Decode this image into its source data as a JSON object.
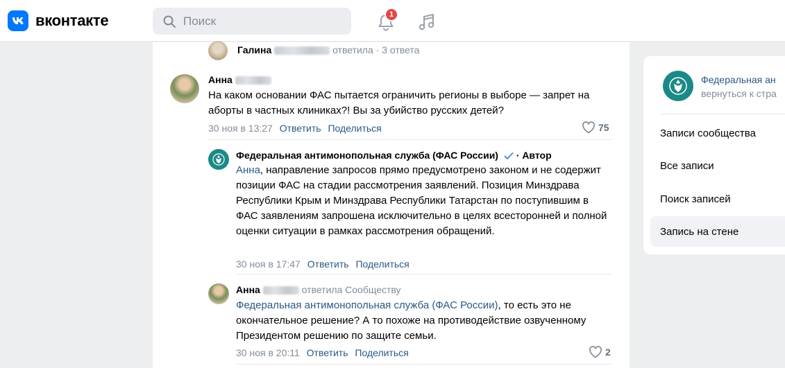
{
  "header": {
    "logo_mark": "vk",
    "logo_text": "вконтакте",
    "search_placeholder": "Поиск",
    "notifications_count": "1",
    "icons": [
      "search-icon",
      "bell-icon",
      "music-icon"
    ]
  },
  "thread_top": {
    "author_first": "Галина",
    "action": "ответила · 3 ответа"
  },
  "comment1": {
    "author_first": "Анна",
    "text": "На каком основании ФАС пытается ограничить регионы в выборе — запрет на аборты в частных клиниках?! Вы за убийство русских детей?",
    "date": "30 ноя в 13:27",
    "reply_label": "Ответить",
    "share_label": "Поделиться",
    "likes": "75"
  },
  "comment2": {
    "author": "Федеральная антимонопольная служба (ФАС России)",
    "author_badge": "· Автор",
    "mention": "Анна",
    "text": ", направление запросов прямо предусмотрено законом и не содержит позиции ФАС на стадии рассмотрения заявлений. Позиция Минздрава Республики Крым и Минздрава Республики Татарстан по поступившим в ФАС заявлениям запрошена исключительно в целях всесторонней и полной оценки ситуации в рамках рассмотрения обращений.",
    "date": "30 ноя в 17:47",
    "reply_label": "Ответить",
    "share_label": "Поделиться"
  },
  "comment3": {
    "author_first": "Анна",
    "action": "ответила Сообществу",
    "mention": "Федеральная антимонопольная служба (ФАС России)",
    "text": ", то есть это не окончательное решение? А то похоже на противодействие озвученному Президентом решению по защите семьи.",
    "date": "30 ноя в 20:11",
    "reply_label": "Ответить",
    "share_label": "Поделиться",
    "likes": "2"
  },
  "sidebar": {
    "community_name": "Федеральная ан",
    "back_label": "вернуться к стра",
    "items": [
      {
        "label": "Записи сообщества"
      },
      {
        "label": "Все записи"
      },
      {
        "label": "Поиск записей"
      },
      {
        "label": "Запись на стене"
      }
    ]
  },
  "colors": {
    "accent": "#0077ff",
    "link": "#2a5885",
    "badge": "#e64646",
    "emblem": "#1b8a86"
  }
}
